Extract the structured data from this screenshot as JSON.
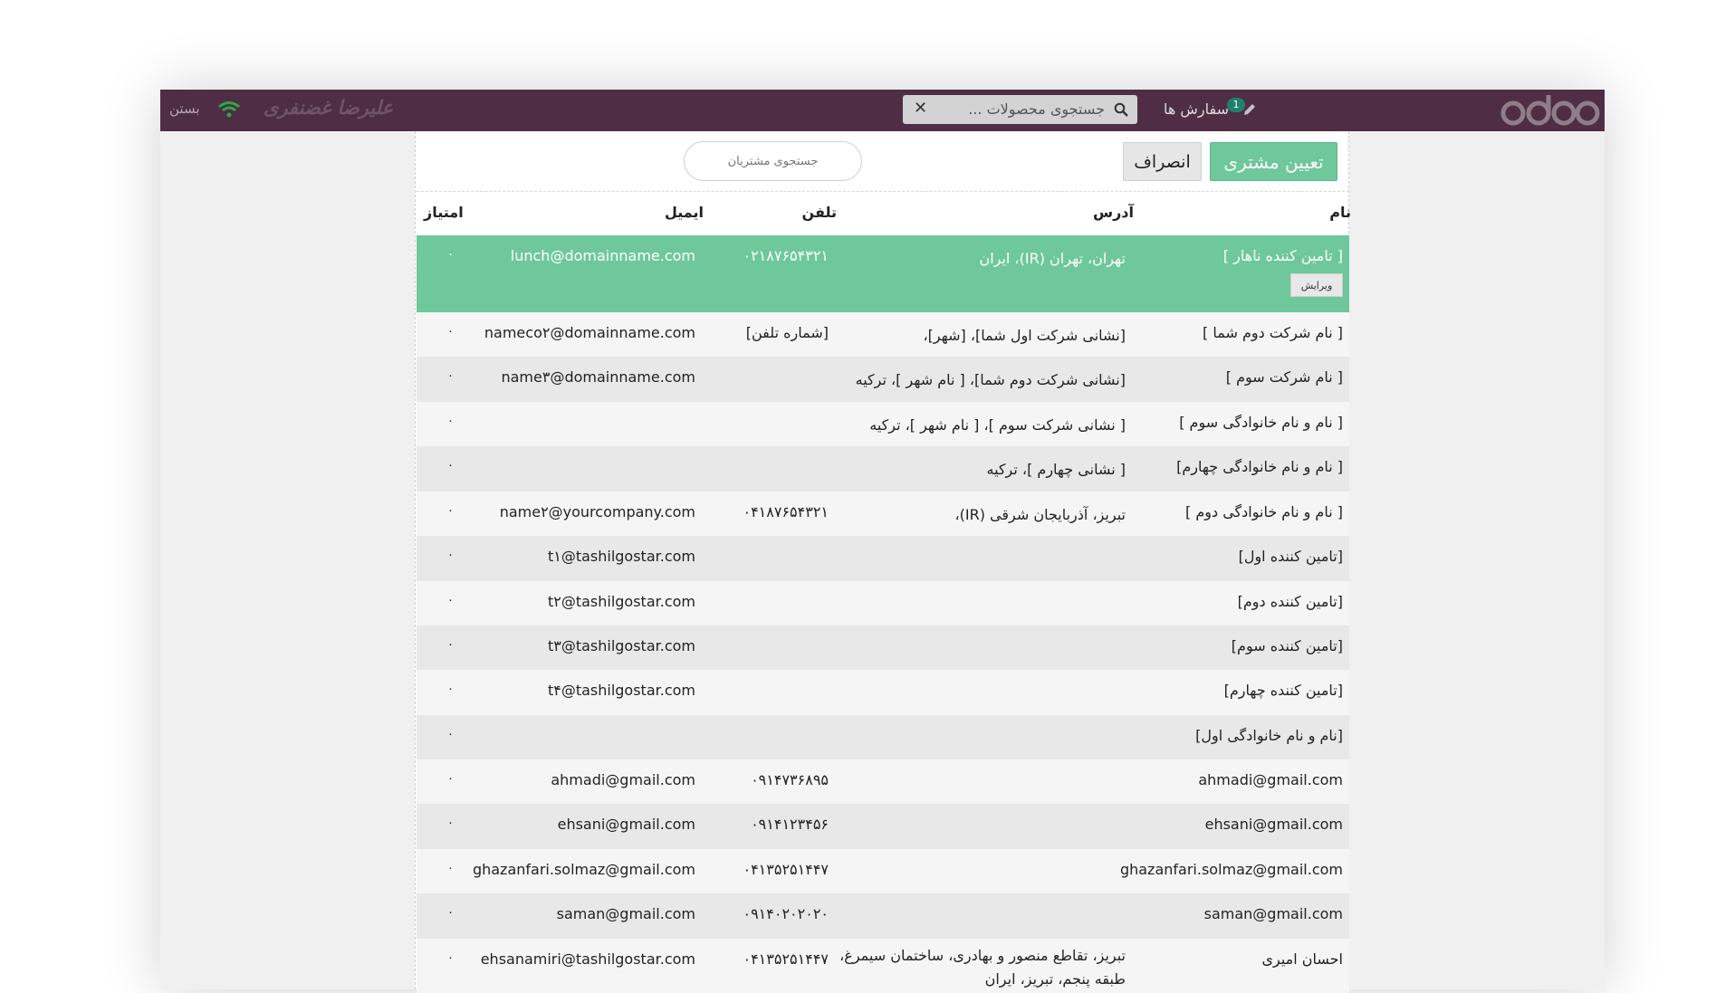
{
  "topbar": {
    "close_label": "بستن",
    "user_name": "علیرضا غضنفری",
    "product_search_placeholder": "جستجوی محصولات ...",
    "orders_label": "سفارش ها",
    "orders_badge": "1",
    "logo_text": "odoo"
  },
  "toolbar": {
    "set_customer_label": "تعیین مشتری",
    "cancel_label": "انصراف",
    "search_customers_placeholder": "جستجوی مشتریان"
  },
  "columns": {
    "name": "نام",
    "address": "آدرس",
    "phone": "تلفن",
    "email": "ایمیل",
    "score": "امتیاز"
  },
  "edit_label": "ویرایش",
  "rows": [
    {
      "name": "[ تامین کننده ناهار ]",
      "address": "تهران، تهران (IR)، ایران",
      "phone": "۰۲۱۸۷۶۵۴۳۲۱",
      "email": "lunch@domainname.com",
      "score": "۰"
    },
    {
      "name": "[ نام شرکت دوم شما ]",
      "address": "[نشانی شرکت اول شما]، [شهر]،",
      "phone": "[شماره تلفن]",
      "email": "nameco۲@domainname.com",
      "score": "۰"
    },
    {
      "name": "[ نام شرکت سوم ]",
      "address": "[نشانی شرکت دوم شما]، [ نام شهر ]، ترکیه",
      "phone": "",
      "email": "name۳@domainname.com",
      "score": "۰"
    },
    {
      "name": "[ نام و نام خانوادگی سوم ]",
      "address": "[ نشانی شرکت سوم ]، [ نام شهر ]، ترکیه",
      "phone": "",
      "email": "",
      "score": "۰"
    },
    {
      "name": "[ نام و نام خانوادگی چهارم]",
      "address": "[ نشانی چهارم ]، ترکیه",
      "phone": "",
      "email": "",
      "score": "۰"
    },
    {
      "name": "[ نام و نام خانوادگی دوم ]",
      "address": "تبریز، آذربایجان شرقی (IR)،",
      "phone": "۰۴۱۸۷۶۵۴۳۲۱",
      "email": "name۲@yourcompany.com",
      "score": "۰"
    },
    {
      "name": "[تامین کننده اول]",
      "address": "",
      "phone": "",
      "email": "t۱@tashilgostar.com",
      "score": "۰"
    },
    {
      "name": "[تامین کننده دوم]",
      "address": "",
      "phone": "",
      "email": "t۲@tashilgostar.com",
      "score": "۰"
    },
    {
      "name": "[تامین کننده سوم]",
      "address": "",
      "phone": "",
      "email": "t۳@tashilgostar.com",
      "score": "۰"
    },
    {
      "name": "[تامین کننده چهارم]",
      "address": "",
      "phone": "",
      "email": "t۴@tashilgostar.com",
      "score": "۰"
    },
    {
      "name": "[نام و نام خانوادگی اول]",
      "address": "",
      "phone": "",
      "email": "",
      "score": "۰"
    },
    {
      "name": "ahmadi@gmail.com",
      "address": "",
      "phone": "۰۹۱۴۷۳۶۸۹۵",
      "email": "ahmadi@gmail.com",
      "score": "۰"
    },
    {
      "name": "ehsani@gmail.com",
      "address": "",
      "phone": "۰۹۱۴۱۲۳۴۵۶",
      "email": "ehsani@gmail.com",
      "score": "۰"
    },
    {
      "name": "ghazanfari.solmaz@gmail.com",
      "address": "",
      "phone": "۰۴۱۳۵۲۵۱۴۴۷",
      "email": "ghazanfari.solmaz@gmail.com",
      "score": "۰"
    },
    {
      "name": "saman@gmail.com",
      "address": "",
      "phone": "۰۹۱۴۰۲۰۲۰۲۰",
      "email": "saman@gmail.com",
      "score": "۰"
    },
    {
      "name": "احسان امیری",
      "address": "تبریز، تقاطع منصور و بهادری، ساختمان سیمرغ،",
      "address2": "طبقه پنجم، تبریز، ایران",
      "phone": "۰۴۱۳۵۲۵۱۴۴۷",
      "email": "ehsanamiri@tashilgostar.com",
      "score": "۰"
    }
  ],
  "colors": {
    "topbar": "#4f2e45",
    "accent_green": "#6ec89b"
  }
}
